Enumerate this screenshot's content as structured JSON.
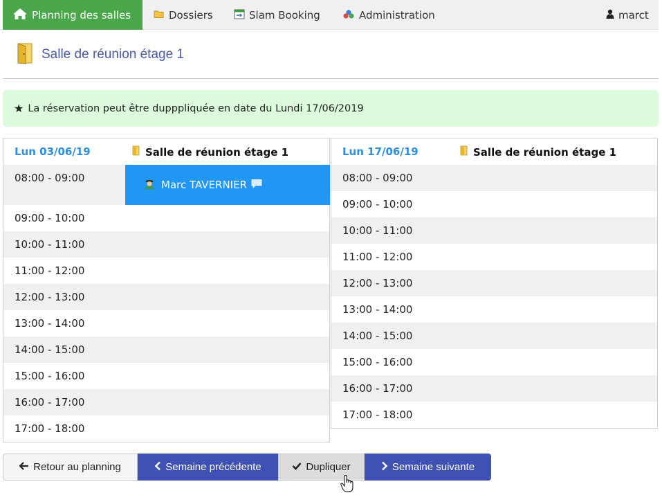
{
  "nav": {
    "home": "Planning des salles",
    "dossiers": "Dossiers",
    "slam": "Slam Booking",
    "admin": "Administration",
    "user": "marct"
  },
  "title": "Salle de réunion étage 1",
  "alert": "La réservation peut être dupppliquée en date du Lundi 17/06/2019",
  "left": {
    "day": "Lun 03/06/19",
    "room": "Salle de réunion étage 1",
    "booking": "Marc TAVERNIER",
    "slots": [
      "08:00 - 09:00",
      "09:00 - 10:00",
      "10:00 - 11:00",
      "11:00 - 12:00",
      "12:00 - 13:00",
      "13:00 - 14:00",
      "14:00 - 15:00",
      "15:00 - 16:00",
      "16:00 - 17:00",
      "17:00 - 18:00"
    ]
  },
  "right": {
    "day": "Lun 17/06/19",
    "room": "Salle de réunion étage 1",
    "slots": [
      "08:00 - 09:00",
      "09:00 - 10:00",
      "10:00 - 11:00",
      "11:00 - 12:00",
      "12:00 - 13:00",
      "13:00 - 14:00",
      "14:00 - 15:00",
      "15:00 - 16:00",
      "16:00 - 17:00",
      "17:00 - 18:00"
    ]
  },
  "buttons": {
    "back": "Retour au planning",
    "prev": "Semaine précédente",
    "dup": "Dupliquer",
    "next": "Semaine suivante"
  },
  "colors": {
    "nav_home": "#4aa64a",
    "booking": "#2196f3",
    "alert_bg": "#dcfadc",
    "button_primary": "#3f51b5",
    "day_label": "#2d8fe0"
  },
  "icons": {
    "home": "home-icon",
    "dossiers": "folder-icon",
    "slam": "calendar-icon",
    "admin": "cubes-icon",
    "user": "user-icon",
    "room": "door-icon",
    "alert": "star-icon",
    "booking_person": "person-icon",
    "booking_comment": "comment-icon",
    "back": "arrow-left-icon",
    "prev": "chevron-left-icon",
    "dup": "check-icon",
    "next": "chevron-right-icon"
  }
}
